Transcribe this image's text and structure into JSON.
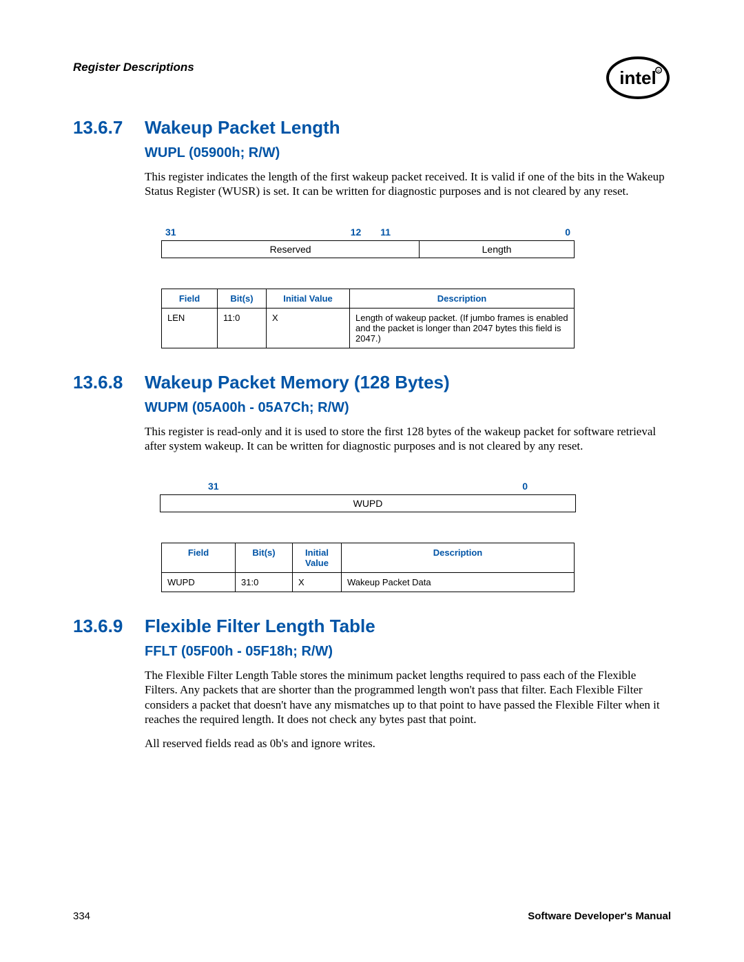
{
  "runningHead": "Register Descriptions",
  "logoAlt": "Intel",
  "sections": {
    "s1": {
      "num": "13.6.7",
      "title": "Wakeup Packet Length",
      "sub": "WUPL (05900h; R/W)",
      "para": "This register indicates the length of the first wakeup packet received. It is valid if one of the bits in the Wakeup Status Register (WUSR) is set. It can be written for diagnostic purposes and is not cleared by any reset.",
      "bits": {
        "b31": "31",
        "b12": "12",
        "b11": "11",
        "b0": "0",
        "left": "Reserved",
        "right": "Length"
      },
      "table": {
        "h": {
          "field": "Field",
          "bits": "Bit(s)",
          "init": "Initial Value",
          "desc": "Description"
        },
        "r": {
          "field": "LEN",
          "bits": "11:0",
          "init": "X",
          "desc": "Length of wakeup packet. (If jumbo frames is enabled and the packet is longer than 2047 bytes this field is 2047.)"
        }
      }
    },
    "s2": {
      "num": "13.6.8",
      "title": "Wakeup Packet Memory (128 Bytes)",
      "sub": "WUPM (05A00h - 05A7Ch; R/W)",
      "para": "This register is read-only and it is used to store the first 128 bytes of the wakeup packet for software retrieval after system wakeup. It can be written for diagnostic purposes and is not cleared by any reset.",
      "bits": {
        "b31": "31",
        "b0": "0",
        "cell": "WUPD"
      },
      "table": {
        "h": {
          "field": "Field",
          "bits": "Bit(s)",
          "init": "Initial Value",
          "desc": "Description"
        },
        "r": {
          "field": "WUPD",
          "bits": "31:0",
          "init": "X",
          "desc": "Wakeup Packet Data"
        }
      }
    },
    "s3": {
      "num": "13.6.9",
      "title": "Flexible Filter Length Table",
      "sub": "FFLT (05F00h - 05F18h; R/W)",
      "para1": "The Flexible Filter Length Table stores the minimum packet lengths required to pass each of the Flexible Filters. Any packets that are shorter than the programmed length won't pass that filter. Each Flexible Filter considers a packet that doesn't have any mismatches up to that point to have passed the Flexible Filter when it reaches the required length. It does not check any bytes past that point.",
      "para2": "All reserved fields read as 0b's and ignore writes."
    }
  },
  "footer": {
    "page": "334",
    "manual": "Software Developer's Manual"
  }
}
